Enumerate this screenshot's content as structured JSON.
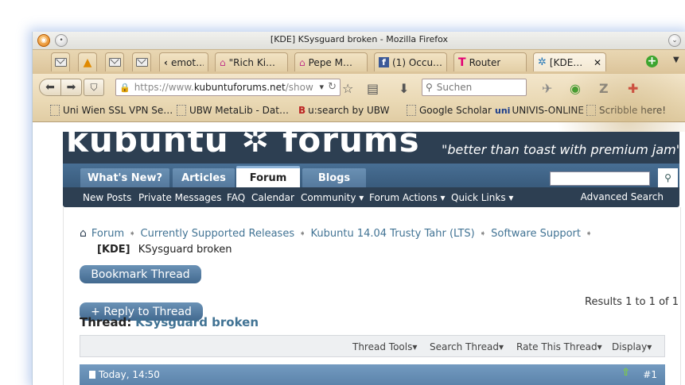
{
  "window": {
    "title": "[KDE] KSysguard broken - Mozilla Firefox"
  },
  "tabs": [
    {
      "label": "",
      "icon": "mail-icon"
    },
    {
      "label": "",
      "icon": "warning-icon"
    },
    {
      "label": "",
      "icon": "mail-icon"
    },
    {
      "label": "",
      "icon": "mail-icon"
    },
    {
      "label": "emot…",
      "icon": "chevron-left-icon"
    },
    {
      "label": "\"Rich Ki…",
      "icon": "home-icon"
    },
    {
      "label": "Pepe M…",
      "icon": "home-icon"
    },
    {
      "label": "(1) Occu…",
      "icon": "facebook-icon"
    },
    {
      "label": "Router",
      "icon": "telekom-icon"
    },
    {
      "label": "[KDE…",
      "icon": "kubuntu-icon"
    }
  ],
  "navbar": {
    "url_prefix": "https://www.",
    "url_domain": "kubuntuforums.net",
    "url_rest": "/show",
    "search_placeholder": "Suchen"
  },
  "bookmarks": [
    {
      "label": "Uni Wien SSL VPN Se…"
    },
    {
      "label": "UBW MetaLib - Dat…"
    },
    {
      "label": "u:search by UBW"
    },
    {
      "label": "Google Scholar"
    },
    {
      "label": "UNIVIS-ONLINE"
    },
    {
      "label": "Scribble here!"
    }
  ],
  "banner": {
    "logo": "kubuntu ✲ forums",
    "slogan": "\"better than toast with premium jam\""
  },
  "forum_tabs": [
    "What's New?",
    "Articles",
    "Forum",
    "Blogs"
  ],
  "subnav": {
    "items": [
      "New Posts",
      "Private Messages",
      "FAQ",
      "Calendar",
      "Community ▾",
      "Forum Actions ▾",
      "Quick Links ▾"
    ],
    "advanced_search": "Advanced Search"
  },
  "breadcrumb": [
    "Forum",
    "Currently Supported Releases",
    "Kubuntu 14.04 Trusty Tahr (LTS)",
    "Software Support"
  ],
  "current": {
    "prefix": "[KDE]",
    "title": "KSysguard broken"
  },
  "buttons": {
    "bookmark": "Bookmark Thread",
    "reply": "+ Reply to Thread"
  },
  "results": "Results 1 to 1 of 1",
  "thread": {
    "label": "Thread:",
    "title": "KSysguard broken"
  },
  "controls": [
    "Thread Tools▾",
    "Search Thread▾",
    "Rate This Thread▾",
    "Display▾"
  ],
  "post": {
    "date": "Today, 14:50",
    "number": "#1"
  }
}
